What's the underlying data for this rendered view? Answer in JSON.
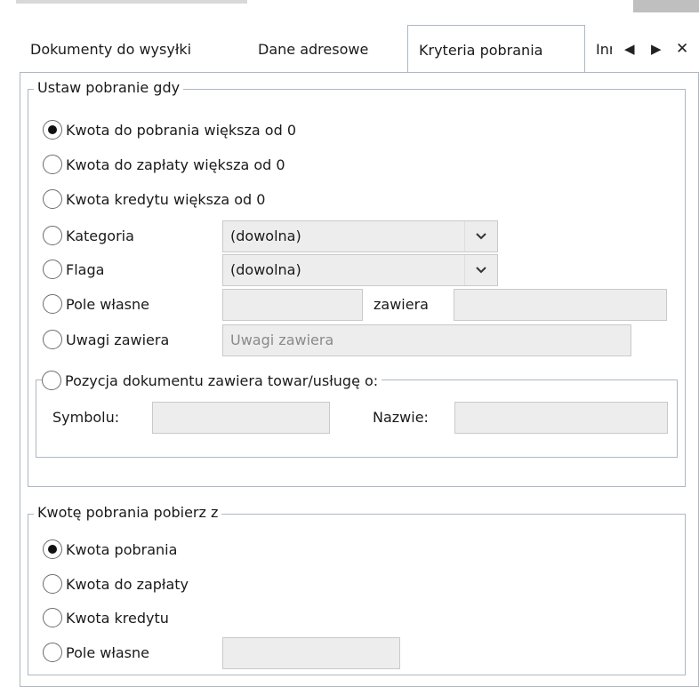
{
  "tabs": [
    {
      "label": "Dokumenty do wysyłki",
      "active": false
    },
    {
      "label": "Dane adresowe",
      "active": false
    },
    {
      "label": "Kryteria pobrania",
      "active": true
    },
    {
      "label": "Inne",
      "active": false
    }
  ],
  "tab_nav": {
    "prev": "◀",
    "next": "▶",
    "close": "✕"
  },
  "group1": {
    "legend": "Ustaw pobranie gdy",
    "options": [
      {
        "label": "Kwota do pobrania większa od 0",
        "checked": true
      },
      {
        "label": "Kwota do zapłaty większa od 0",
        "checked": false
      },
      {
        "label": "Kwota kredytu większa od 0",
        "checked": false
      },
      {
        "label": "Kategoria",
        "checked": false
      },
      {
        "label": "Flaga",
        "checked": false
      },
      {
        "label": "Pole własne",
        "checked": false
      },
      {
        "label": "Uwagi zawiera",
        "checked": false
      }
    ],
    "kategoria_value": "(dowolna)",
    "flaga_value": "(dowolna)",
    "pole_wlasne_value": "",
    "zawiera_label": "zawiera",
    "zawiera_value": "",
    "uwagi_placeholder": "Uwagi zawiera",
    "sub": {
      "legend": "Pozycja dokumentu zawiera towar/usługę o:",
      "checked": false,
      "symbol_label": "Symbolu:",
      "symbol_value": "",
      "name_label": "Nazwie:",
      "name_value": ""
    }
  },
  "group2": {
    "legend": "Kwotę pobrania pobierz z",
    "options": [
      {
        "label": "Kwota pobrania",
        "checked": true
      },
      {
        "label": "Kwota do zapłaty",
        "checked": false
      },
      {
        "label": "Kwota kredytu",
        "checked": false
      },
      {
        "label": "Pole własne",
        "checked": false
      }
    ],
    "pole_wlasne_value": ""
  },
  "colors": {
    "border": "#aeb7c2",
    "field_bg": "#ededed",
    "text": "#1a1a1a"
  }
}
